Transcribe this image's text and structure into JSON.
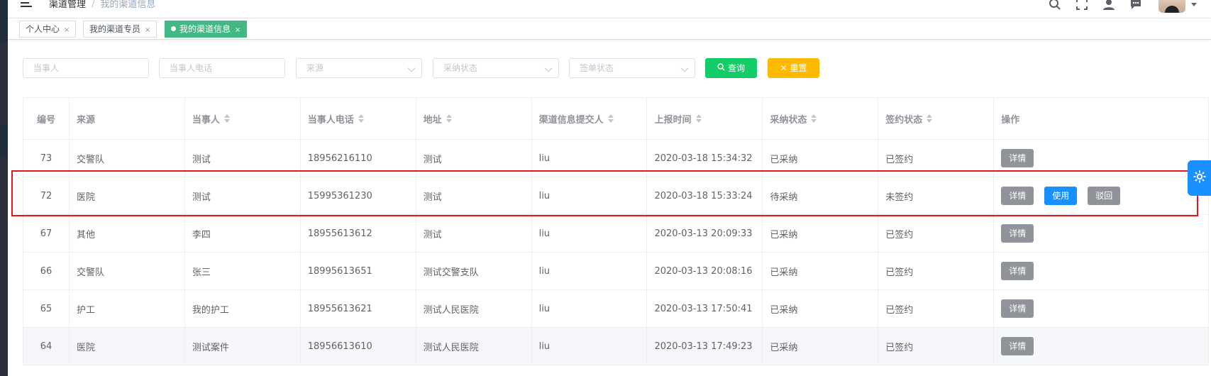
{
  "header": {
    "breadcrumb": [
      "渠道管理",
      "我的渠道信息"
    ],
    "separator": "/",
    "icons": [
      "search-icon",
      "fullscreen-icon",
      "user-icon",
      "message-icon"
    ]
  },
  "tags": [
    {
      "label": "个人中心",
      "close": "×",
      "active": false
    },
    {
      "label": "我的渠道专员",
      "close": "×",
      "active": false
    },
    {
      "label": "我的渠道信息",
      "close": "×",
      "active": true
    }
  ],
  "filters": {
    "party_placeholder": "当事人",
    "phone_placeholder": "当事人电话",
    "source_placeholder": "来源",
    "adopt_placeholder": "采纳状态",
    "sign_placeholder": "签单状态",
    "search_label": "查询",
    "reset_label": "重置"
  },
  "table": {
    "columns": [
      "编号",
      "来源",
      "当事人",
      "当事人电话",
      "地址",
      "渠道信息提交人",
      "上报时间",
      "采纳状态",
      "签约状态",
      "操作"
    ],
    "rows": [
      {
        "id": "73",
        "source": "交警队",
        "party": "测试",
        "phone": "18956216110",
        "address": "测试",
        "submitter": "liu",
        "time": "2020-03-18 15:34:32",
        "adopt": "已采纳",
        "sign": "已签约",
        "actions": [
          "详情"
        ]
      },
      {
        "id": "72",
        "source": "医院",
        "party": "测试",
        "phone": "15995361230",
        "address": "测试",
        "submitter": "liu",
        "time": "2020-03-18 15:33:24",
        "adopt": "待采纳",
        "sign": "未签约",
        "actions": [
          "详情",
          "使用",
          "驳回"
        ]
      },
      {
        "id": "67",
        "source": "其他",
        "party": "李四",
        "phone": "18955613612",
        "address": "测试",
        "submitter": "liu",
        "time": "2020-03-13 20:09:33",
        "adopt": "已采纳",
        "sign": "已签约",
        "actions": [
          "详情"
        ]
      },
      {
        "id": "66",
        "source": "交警队",
        "party": "张三",
        "phone": "18995613651",
        "address": "测试交警支队",
        "submitter": "liu",
        "time": "2020-03-13 20:08:16",
        "adopt": "已采纳",
        "sign": "已签约",
        "actions": [
          "详情"
        ]
      },
      {
        "id": "65",
        "source": "护工",
        "party": "我的护工",
        "phone": "18955613621",
        "address": "测试人民医院",
        "submitter": "liu",
        "time": "2020-03-13 17:50:41",
        "adopt": "已采纳",
        "sign": "已签约",
        "actions": [
          "详情"
        ]
      },
      {
        "id": "64",
        "source": "医院",
        "party": "测试案件",
        "phone": "18956613610",
        "address": "测试人民医院",
        "submitter": "liu",
        "time": "2020-03-13 17:49:23",
        "adopt": "已采纳",
        "sign": "已签约",
        "actions": [
          "详情"
        ]
      }
    ]
  },
  "colors": {
    "search_button": "#13ce66",
    "reset_button": "#ffba00",
    "active_tag": "#42b983",
    "use_button": "#1890ff",
    "detail_button": "#909399",
    "highlight_box": "#e8141b"
  }
}
